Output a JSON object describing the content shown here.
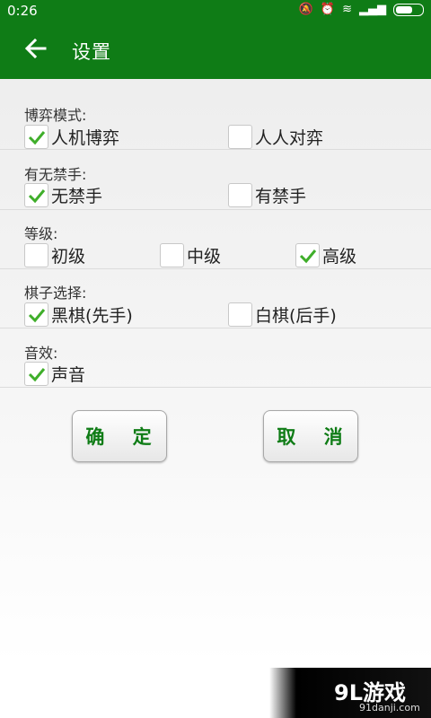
{
  "status": {
    "time": "0:26"
  },
  "header": {
    "title": "设置"
  },
  "sections": [
    {
      "label": "博弈模式:",
      "options": [
        {
          "label": "人机博弈",
          "checked": true
        },
        {
          "label": "人人对弈",
          "checked": false
        }
      ]
    },
    {
      "label": "有无禁手:",
      "options": [
        {
          "label": "无禁手",
          "checked": true
        },
        {
          "label": "有禁手",
          "checked": false
        }
      ]
    },
    {
      "label": "等级:",
      "options": [
        {
          "label": "初级",
          "checked": false
        },
        {
          "label": "中级",
          "checked": false
        },
        {
          "label": "高级",
          "checked": true
        }
      ]
    },
    {
      "label": "棋子选择:",
      "options": [
        {
          "label": "黑棋(先手)",
          "checked": true
        },
        {
          "label": "白棋(后手)",
          "checked": false
        }
      ]
    },
    {
      "label": "音效:",
      "options": [
        {
          "label": "声音",
          "checked": true
        }
      ]
    }
  ],
  "buttons": {
    "confirm": "确 定",
    "cancel": "取 消"
  },
  "watermark": {
    "brand": "9L游戏",
    "domain": "91danji.com"
  },
  "colors": {
    "accent": "#0f7c16",
    "check": "#3fae2a"
  },
  "icons": {
    "back": "arrow-left-icon",
    "check": "checkmark-icon"
  }
}
